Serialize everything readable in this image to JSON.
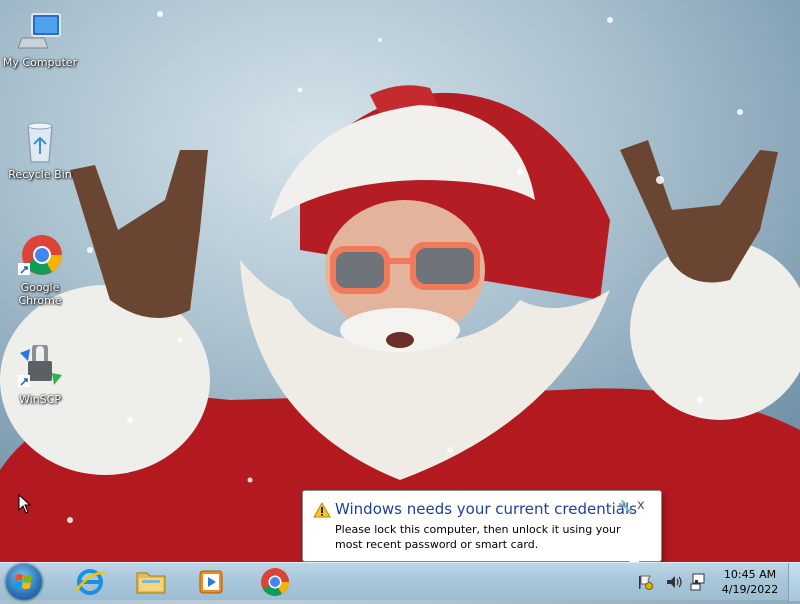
{
  "desktop": {
    "icons": [
      {
        "label": "My Computer"
      },
      {
        "label": "Recycle Bin"
      },
      {
        "label": "Google Chrome"
      },
      {
        "label": "WinSCP"
      }
    ]
  },
  "notification": {
    "title": "Windows needs your current credentials",
    "body": "Please lock this computer, then unlock it using your most recent password or smart card.",
    "close_label": "x"
  },
  "taskbar": {
    "pinned": [
      "internet-explorer",
      "file-explorer",
      "media-player",
      "google-chrome"
    ],
    "clock": {
      "time": "10:45 AM",
      "date": "4/19/2022"
    }
  },
  "colors": {
    "notification_title": "#1e3f9e",
    "taskbar": "#a9c7da"
  }
}
